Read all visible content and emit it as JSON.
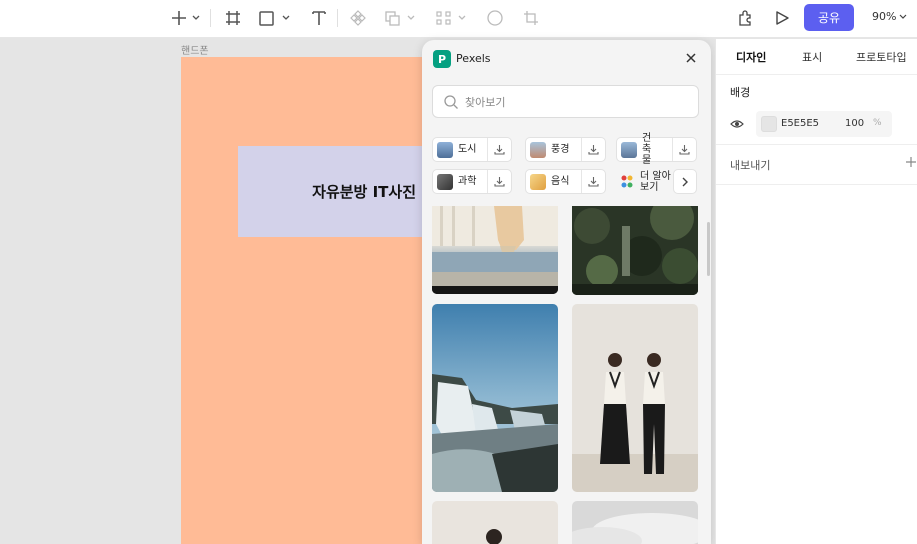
{
  "toolbar": {
    "share_label": "공유",
    "zoom": "90%",
    "tools": [
      "add-icon",
      "frame-icon",
      "shape-icon",
      "text-icon",
      "component-icon",
      "boolean-icon",
      "align-icon",
      "mask-icon",
      "crop-icon"
    ],
    "accent_color": "#5c5ff0"
  },
  "canvas": {
    "frame_label": "핸드폰",
    "frame_color": "#ffbb96",
    "banner_text": "자유분방 IT사진",
    "banner_color": "#d3d2ea"
  },
  "pexels": {
    "title": "Pexels",
    "search_placeholder": "찾아보기",
    "categories": [
      {
        "label": "도시",
        "thumb": "#6f8fb8"
      },
      {
        "label": "풍경",
        "thumb": "#8fb0c8"
      },
      {
        "label": "건축물",
        "thumb": "#7a98b8"
      },
      {
        "label": "과학",
        "thumb": "#5a5a5a"
      },
      {
        "label": "음식",
        "thumb": "#f0c070"
      }
    ],
    "more_label": "더 알아보기",
    "brand_color": "#05a081"
  },
  "sidebar": {
    "tabs": [
      "디자인",
      "표시",
      "프로토타입"
    ],
    "background_title": "배경",
    "background_hex": "E5E5E5",
    "background_opacity": "100",
    "percent_sign": "%",
    "export_title": "내보내기"
  }
}
